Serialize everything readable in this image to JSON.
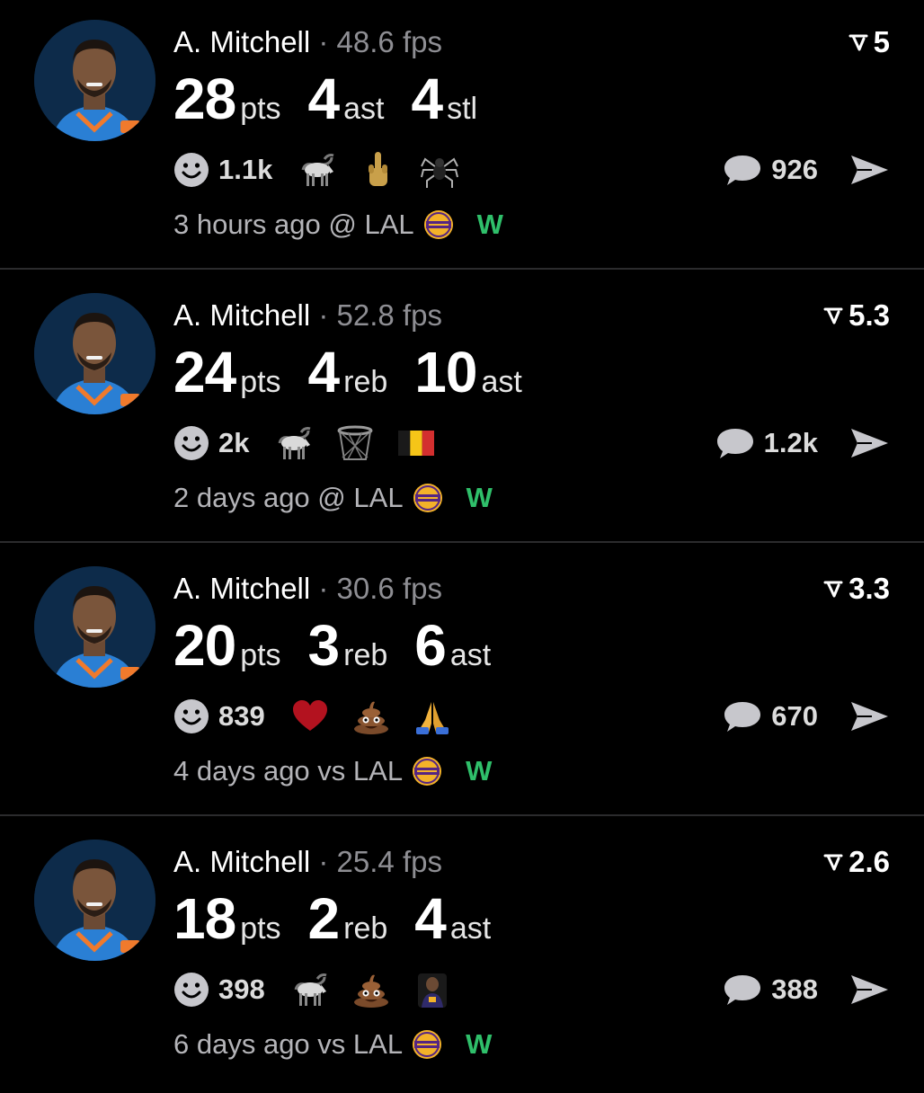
{
  "posts": [
    {
      "player": "A. Mitchell",
      "fps": "48.6 fps",
      "rating": "5",
      "stats": [
        {
          "value": "28",
          "unit": "pts"
        },
        {
          "value": "4",
          "unit": "ast"
        },
        {
          "value": "4",
          "unit": "stl"
        }
      ],
      "reaction_count": "1.1k",
      "emojis": [
        "goat-emoji",
        "middle-finger-emoji",
        "spider-emoji"
      ],
      "comment_count": "926",
      "time": "3 hours ago",
      "venue": "@",
      "opponent": "LAL",
      "result": "W"
    },
    {
      "player": "A. Mitchell",
      "fps": "52.8 fps",
      "rating": "5.3",
      "stats": [
        {
          "value": "24",
          "unit": "pts"
        },
        {
          "value": "4",
          "unit": "reb"
        },
        {
          "value": "10",
          "unit": "ast"
        }
      ],
      "reaction_count": "2k",
      "emojis": [
        "goat-emoji",
        "basketball-hoop-emoji",
        "belgium-flag-emoji"
      ],
      "comment_count": "1.2k",
      "time": "2 days ago",
      "venue": "@",
      "opponent": "LAL",
      "result": "W"
    },
    {
      "player": "A. Mitchell",
      "fps": "30.6 fps",
      "rating": "3.3",
      "stats": [
        {
          "value": "20",
          "unit": "pts"
        },
        {
          "value": "3",
          "unit": "reb"
        },
        {
          "value": "6",
          "unit": "ast"
        }
      ],
      "reaction_count": "839",
      "emojis": [
        "red-heart-emoji",
        "poop-emoji",
        "praying-hands-emoji"
      ],
      "comment_count": "670",
      "time": "4 days ago",
      "venue": "vs",
      "opponent": "LAL",
      "result": "W"
    },
    {
      "player": "A. Mitchell",
      "fps": "25.4 fps",
      "rating": "2.6",
      "stats": [
        {
          "value": "18",
          "unit": "pts"
        },
        {
          "value": "2",
          "unit": "reb"
        },
        {
          "value": "4",
          "unit": "ast"
        }
      ],
      "reaction_count": "398",
      "emojis": [
        "goat-emoji",
        "poop-emoji",
        "player-image-emoji"
      ],
      "comment_count": "388",
      "time": "6 days ago",
      "venue": "vs",
      "opponent": "LAL",
      "result": "W"
    }
  ],
  "colors": {
    "background": "#000000",
    "muted_text": "#8e8e93",
    "win_green": "#2fbf6a",
    "divider": "#2b2b2d"
  }
}
